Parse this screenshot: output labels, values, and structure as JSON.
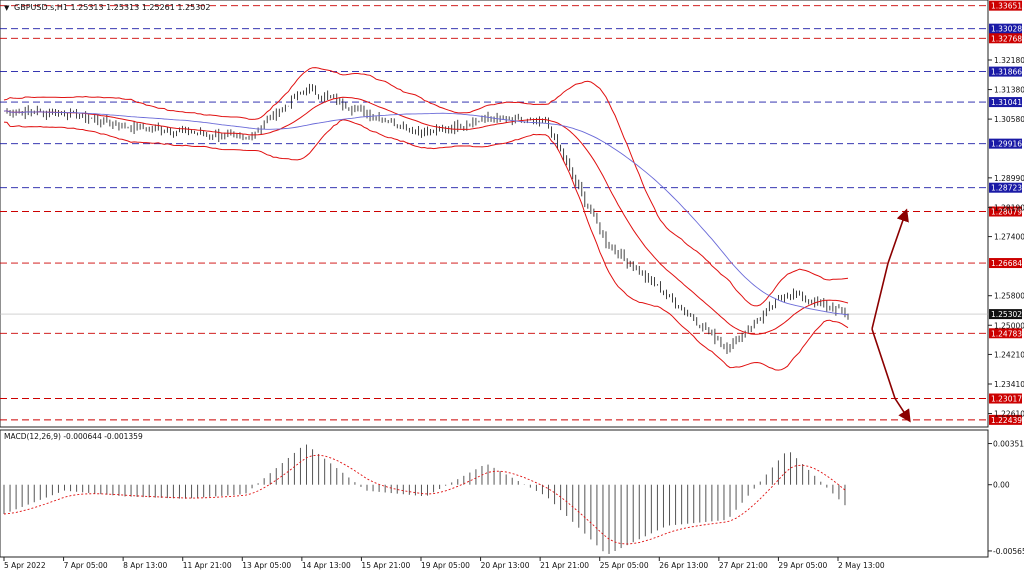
{
  "header": {
    "symbol_line": "GBPUSD.s,H1  1.25313 1.25313 1.25261 1.25302"
  },
  "macd": {
    "label": "MACD(12,26,9) -0.000644 -0.001359",
    "ticks": [
      "0.003515",
      "0.00",
      "-0.005654"
    ],
    "range": [
      -0.006,
      0.0045
    ]
  },
  "price_axis": {
    "range": [
      1.223,
      1.3375
    ],
    "ticks": [
      "1.32180",
      "1.31380",
      "1.30580",
      "1.28990",
      "1.28190",
      "1.27400",
      "1.25800",
      "1.25000",
      "1.24210",
      "1.23410",
      "1.22610"
    ]
  },
  "current_price": "1.25302",
  "levels": [
    {
      "label": "1.33651",
      "value": 1.33651,
      "color": "#cc0000",
      "style": "red"
    },
    {
      "label": "1.33028",
      "value": 1.33028,
      "color": "#1a1aa6",
      "style": "blue"
    },
    {
      "label": "1.32768",
      "value": 1.32768,
      "color": "#cc0000",
      "style": "red"
    },
    {
      "label": "1.31866",
      "value": 1.31866,
      "color": "#1a1aa6",
      "style": "blue"
    },
    {
      "label": "1.31041",
      "value": 1.31041,
      "color": "#1a1aa6",
      "style": "blue"
    },
    {
      "label": "1.29916",
      "value": 1.29916,
      "color": "#1a1aa6",
      "style": "blue"
    },
    {
      "label": "1.28723",
      "value": 1.28723,
      "color": "#1a1aa6",
      "style": "blue"
    },
    {
      "label": "1.28079",
      "value": 1.28079,
      "color": "#cc0000",
      "style": "red"
    },
    {
      "label": "1.26684",
      "value": 1.26684,
      "color": "#cc0000",
      "style": "red"
    },
    {
      "label": "1.24783",
      "value": 1.24783,
      "color": "#cc0000",
      "style": "red"
    },
    {
      "label": "1.23017",
      "value": 1.23017,
      "color": "#cc0000",
      "style": "red"
    },
    {
      "label": "1.22439",
      "value": 1.22439,
      "color": "#cc0000",
      "style": "red"
    }
  ],
  "time_axis": {
    "labels": [
      "5 Apr 2022",
      "7 Apr 05:00",
      "8 Apr 13:00",
      "11 Apr 21:00",
      "13 Apr 05:00",
      "14 Apr 13:00",
      "15 Apr 21:00",
      "19 Apr 05:00",
      "20 Apr 13:00",
      "21 Apr 21:00",
      "25 Apr 05:00",
      "26 Apr 13:00",
      "27 Apr 21:00",
      "29 Apr 05:00",
      "2 May 13:00"
    ]
  },
  "chart_data": {
    "type": "line",
    "x": [
      0,
      1,
      2,
      3,
      4,
      5,
      6,
      7,
      8,
      9,
      10,
      11,
      12,
      13,
      14
    ],
    "price_path": [
      1.308,
      1.3075,
      1.304,
      1.3025,
      1.3005,
      1.314,
      1.3075,
      1.302,
      1.306,
      1.3045,
      1.272,
      1.258,
      1.244,
      1.259,
      1.253
    ],
    "macd_hist": [
      -0.0025,
      -0.0005,
      -0.001,
      -0.0012,
      -0.0008,
      0.0035,
      -0.0005,
      -0.001,
      0.0018,
      -0.001,
      -0.006,
      -0.0035,
      -0.003,
      0.003,
      -0.002
    ],
    "forecast": {
      "start": 1.249,
      "up_target": 1.2808,
      "down_target": 1.2244
    },
    "colors": {
      "bands": "#e01010",
      "ma": "#6a6ad8",
      "macd_signal": "#e01010",
      "arrow": "#8b0000"
    }
  }
}
